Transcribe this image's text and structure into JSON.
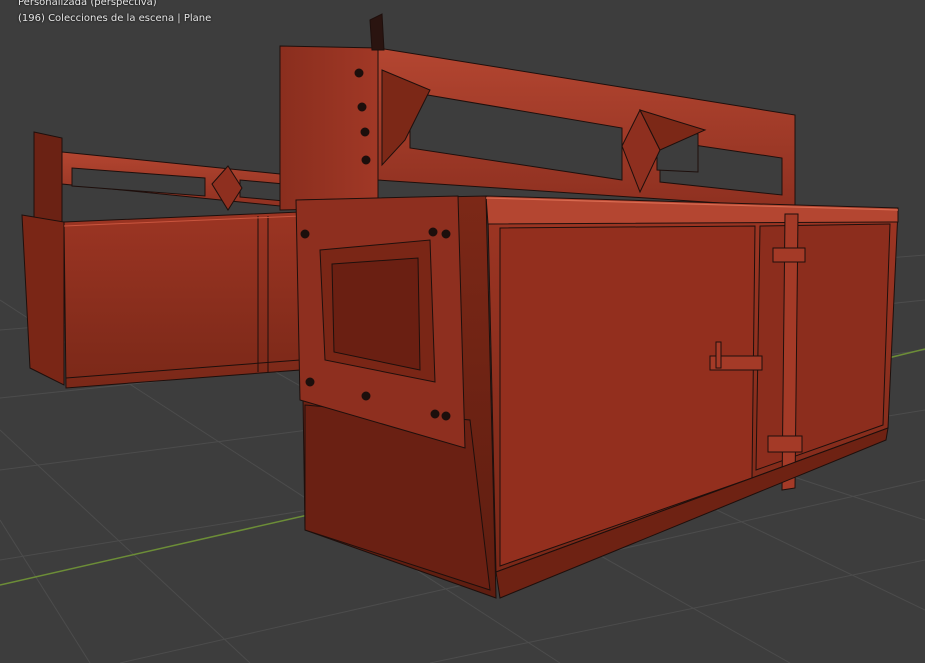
{
  "viewport": {
    "view_mode": "Personalizada (perspectiva)",
    "frame": "(196)",
    "collection": "Colecciones de la escena",
    "active_object": "Plane"
  },
  "colors": {
    "background": "#3d3d3d",
    "grid_line": "#4c4c4c",
    "x_axis": "#6c8d37",
    "model_base": "#a13a28",
    "wire": "#1e0f0c"
  }
}
